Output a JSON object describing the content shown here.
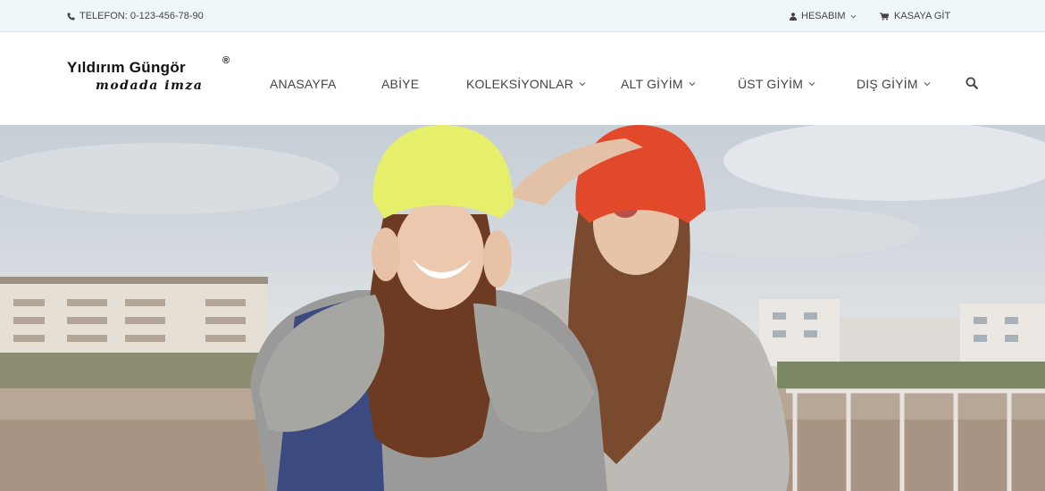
{
  "topbar": {
    "phone_label": "TELEFON: 0-123-456-78-90",
    "account_label": "HESABIM",
    "cart_label": "KASAYA GİT"
  },
  "logo": {
    "brand": "Yıldırım Güngör",
    "registered": "®",
    "tagline": "modada imza"
  },
  "nav": {
    "items": [
      {
        "label": "ANASAYFA",
        "has_dropdown": false
      },
      {
        "label": "ABİYE",
        "has_dropdown": false
      },
      {
        "label": "KOLEKSİYONLAR",
        "has_dropdown": true
      },
      {
        "label": "ALT GİYİM",
        "has_dropdown": true
      },
      {
        "label": "ÜST GİYİM",
        "has_dropdown": true
      },
      {
        "label": "DIŞ GİYİM",
        "has_dropdown": true
      }
    ],
    "search_icon": "search-icon"
  },
  "hero": {
    "image": "two young women wearing yellow and red beanies"
  },
  "colors": {
    "topbar_bg": "#eff7fa",
    "text": "#444444",
    "beanie_yellow": "#e6ef6a",
    "beanie_red": "#e2492a"
  }
}
